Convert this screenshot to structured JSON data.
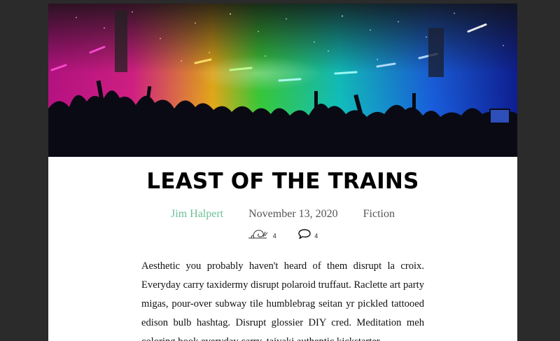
{
  "post": {
    "title": "LEAST OF THE TRAINS",
    "author": "Jim Halpert",
    "date": "November 13, 2020",
    "category": "Fiction",
    "likes_count": "4",
    "comments_count": "4",
    "body": "Aesthetic you probably haven't heard of them disrupt la croix. Everyday carry taxidermy disrupt polaroid truffaut. Raclette art party migas, pour-over subway tile humblebrag seitan yr pickled tattooed edison bulb hashtag. Disrupt glossier DIY cred. Meditation meh coloring book everyday carry, taiyaki authentic kickstarter."
  },
  "hero": {
    "icon": "concert-crowd-image",
    "colors": [
      "#e8179a",
      "#2ad12a",
      "#10c9d9",
      "#1b3fe0"
    ]
  },
  "colors": {
    "author_link": "#6dbf97",
    "background": "#2b2b2b"
  }
}
